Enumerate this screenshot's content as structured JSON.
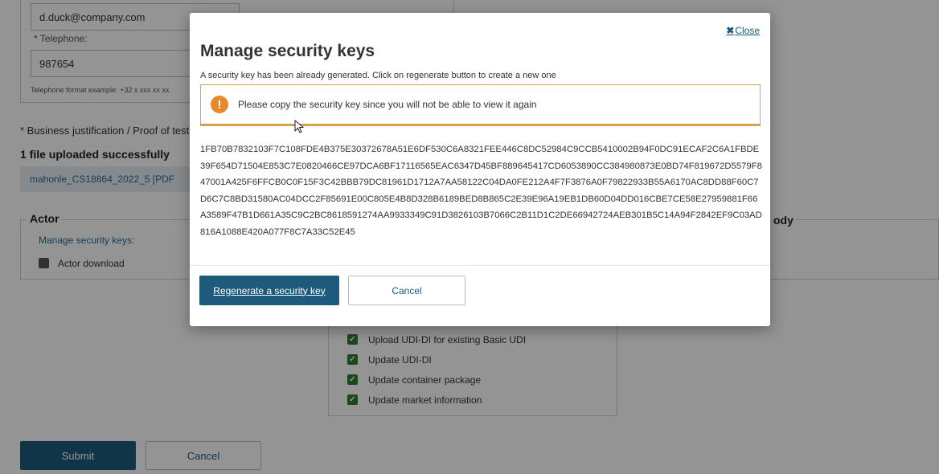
{
  "background": {
    "email_value": "d.duck@company.com",
    "telephone_label": "Telephone:",
    "telephone_value": "987654",
    "telephone_hint": "Telephone format example: +32 x xxx xx xx",
    "justification_label": "Business justification / Proof of testi",
    "upload_status": "1 file uploaded successfully",
    "file_name": "mahonle_CS18864_2022_5 [PDF",
    "actor_legend": "Actor",
    "manage_keys_link": "Manage security keys:",
    "actor_download_label": "Actor download",
    "right_legend_fragment": "ody",
    "permissions": [
      {
        "label": "Upload UDI-DI for existing Basic UDI",
        "checked": true
      },
      {
        "label": "Update UDI-DI",
        "checked": true
      },
      {
        "label": "Update container package",
        "checked": true
      },
      {
        "label": "Update market information",
        "checked": true
      }
    ],
    "submit_label": "Submit",
    "cancel_label": "Cancel"
  },
  "modal": {
    "close_label": "Close",
    "title": "Manage security keys",
    "subtitle": "A security key has been already generated. Click on regenerate button to create a new one",
    "warning_text": "Please copy the security key since you will not be able to view it again",
    "security_key": "1FB70B7832103F7C108FDE4B375E30372678A51E6DF530C6A8321FEE446C8DC52984C9CCB5410002B94F0DC91ECAF2C6A1FBDE39F654D71504E853C7E0820466CE97DCA6BF17116565EAC6347D45BF889645417CD6053890CC384980873E0BD74F819672D5579F847001A425F6FFCB0C0F15F3C42BBB79DC81961D1712A7AA58122C04DA0FE212A4F7F3876A0F79822933B55A6170AC8DD88F60C7D6C7C8BD31580AC04DCC2F85691E00C805E4B8D328B6189BED8B865C2E39E96A19EB1DB60D04DD016CBE7CE58E27959881F66A3589F47B1D661A35C9C2BC8618591274AA9933349C91D3826103B7066C2B11D1C2DE66942724AEB301B5C14A94F2842EF9C03AD816A1088E420A077F8C7A33C52E45",
    "regenerate_label": "Regenerate a security key",
    "cancel_label": "Cancel"
  },
  "icons": {
    "warning": "exclamation-circle-icon",
    "close": "close-icon",
    "checkbox": "check-icon"
  },
  "colors": {
    "primary": "#1d5a7c",
    "warning_border": "#d8a24a",
    "warning_icon": "#e8882c",
    "checkbox_checked": "#2e7d32"
  }
}
